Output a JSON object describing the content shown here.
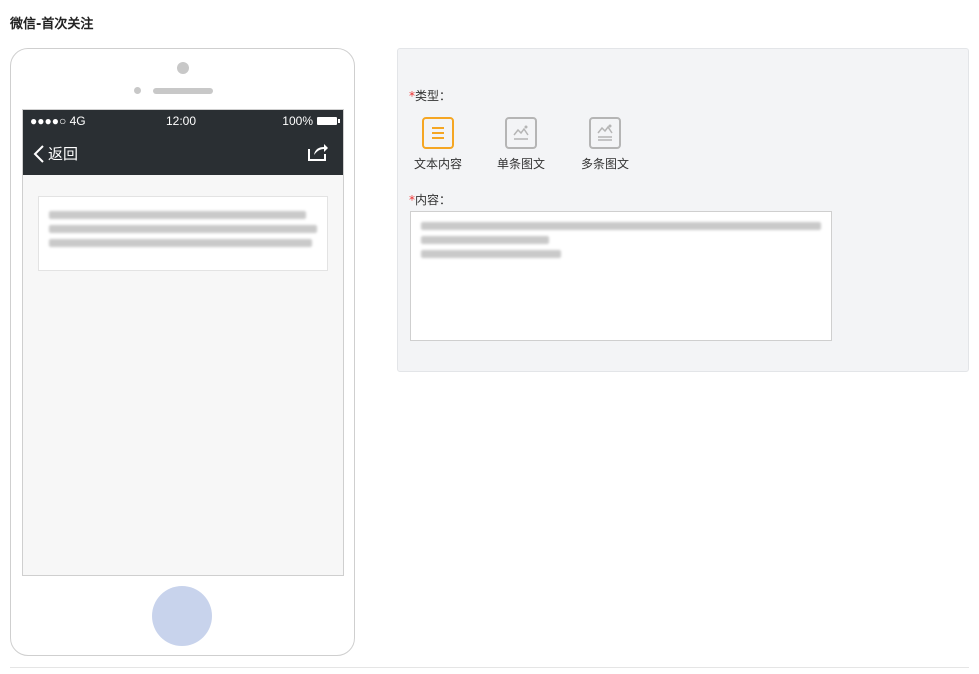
{
  "page": {
    "title": "微信-首次关注"
  },
  "phone": {
    "status": {
      "carrier": "●●●●○ 4G",
      "time": "12:00",
      "battery": "100%"
    },
    "nav": {
      "back_label": "返回"
    }
  },
  "config": {
    "type_label": "类型：",
    "content_label": "内容：",
    "required_mark": "*",
    "types": [
      {
        "label": "文本内容",
        "active": true
      },
      {
        "label": "单条图文",
        "active": false
      },
      {
        "label": "多条图文",
        "active": false
      }
    ]
  },
  "colors": {
    "accent": "#f5a623",
    "dark_bar": "#2a2f33",
    "home_button": "#c8d3ec"
  }
}
